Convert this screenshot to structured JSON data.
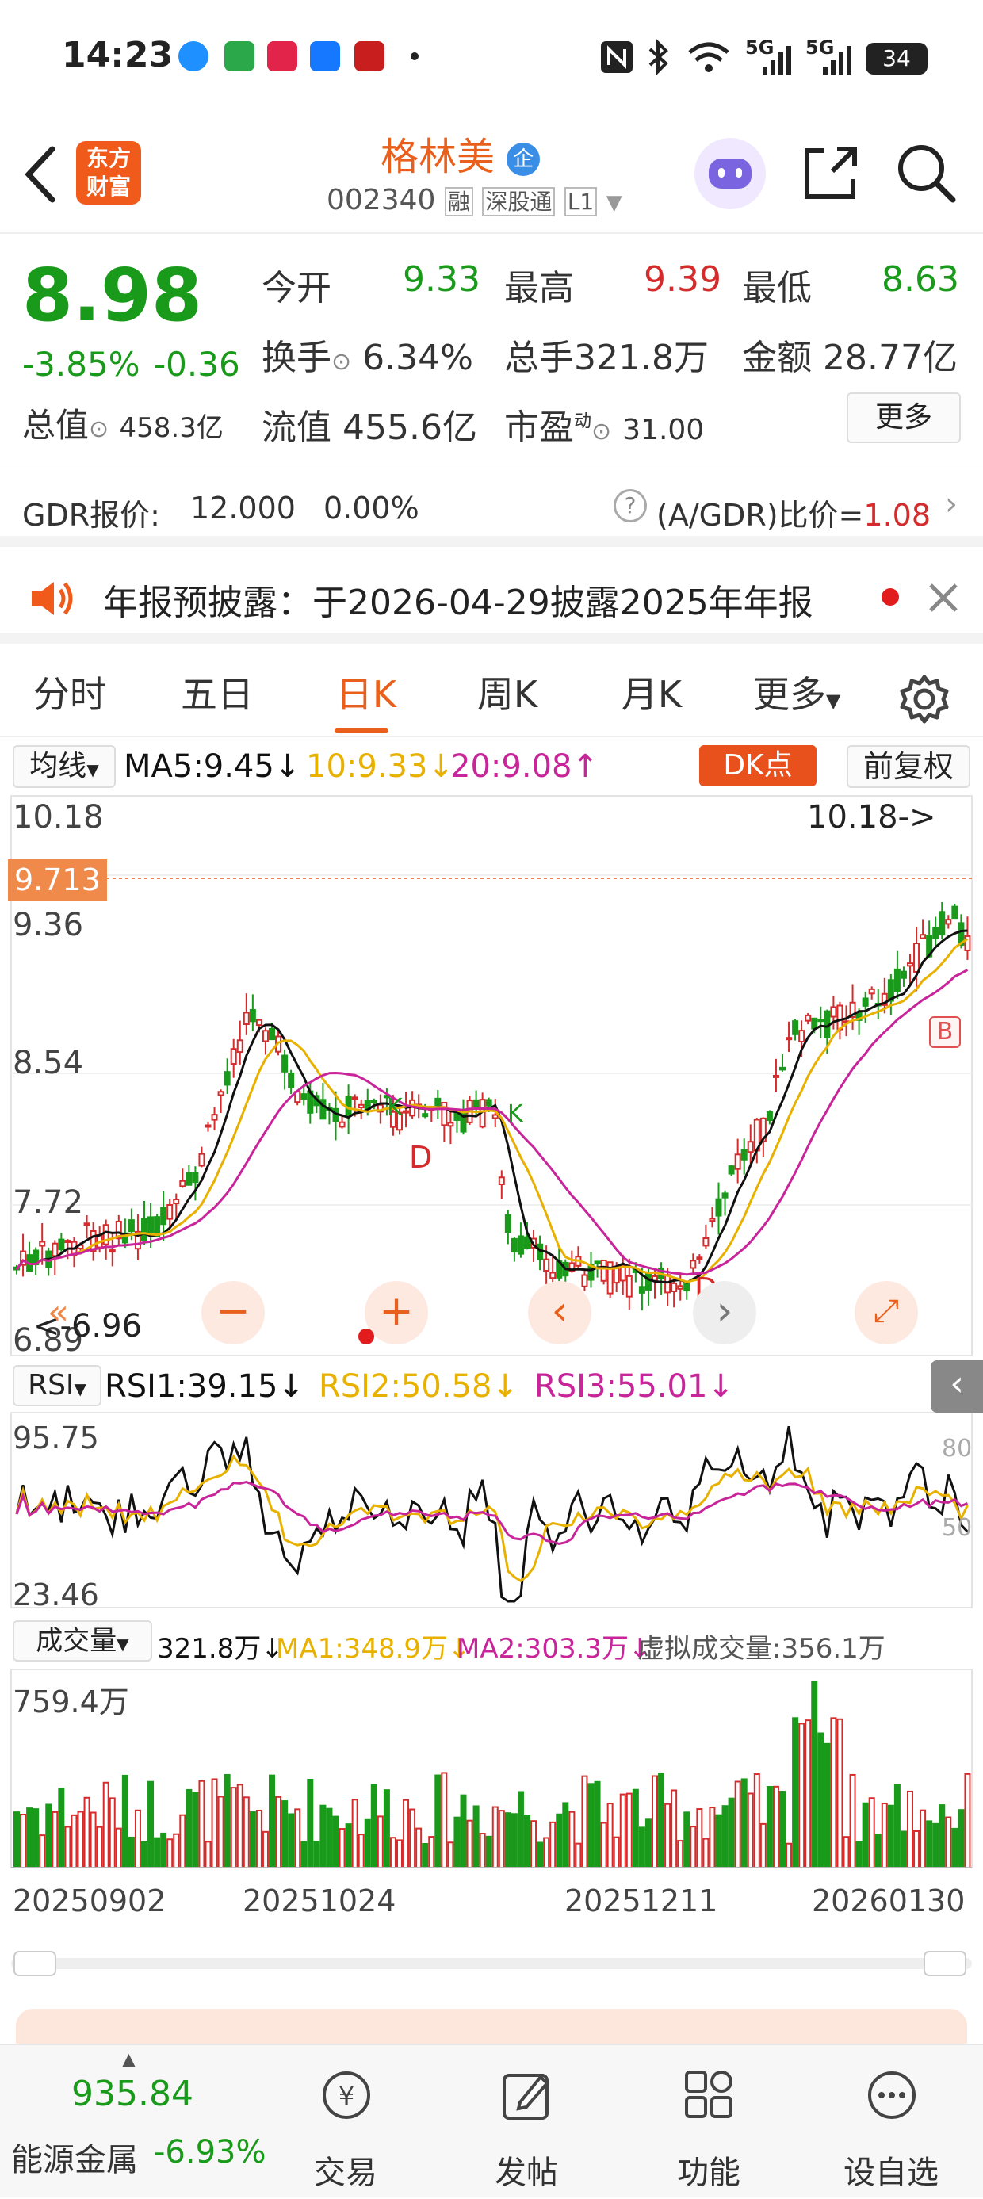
{
  "status": {
    "time": "14:23",
    "battery": "34",
    "network1": "5G",
    "network2": "5G"
  },
  "header": {
    "app_logo_line1": "东方",
    "app_logo_line2": "财富",
    "stock_name": "格林美",
    "badge": "企",
    "code": "002340",
    "tag1": "融",
    "tag2": "深股通",
    "tag3": "L1"
  },
  "quote": {
    "price": "8.98",
    "change_pct": "-3.85%",
    "change": "-0.36",
    "open_label": "今开",
    "open": "9.33",
    "high_label": "最高",
    "high": "9.39",
    "low_label": "最低",
    "low": "8.63",
    "turnover_label": "换手",
    "turnover": "6.34%",
    "volume_label": "总手",
    "volume": "321.8万",
    "amount_label": "金额",
    "amount": "28.77亿",
    "mcap_label": "总值",
    "mcap": "458.3亿",
    "float_label": "流值",
    "float": "455.6亿",
    "pe_label": "市盈",
    "pe_sup": "动",
    "pe": "31.00",
    "more": "更多"
  },
  "gdr": {
    "label": "GDR报价:",
    "price": "12.000",
    "pct": "0.00%",
    "ratio_label": "(A/GDR)比价=",
    "ratio": "1.08"
  },
  "notice": {
    "text": "年报预披露：于2026-04-29披露2025年年报"
  },
  "tabs": [
    "分时",
    "五日",
    "日K",
    "周K",
    "月K",
    "更多"
  ],
  "indicators": {
    "ma_selector": "均线",
    "ma5": "MA5:9.45↓",
    "ma10": "10:9.33↓",
    "ma20": "20:9.08↑",
    "dk_button": "DK点",
    "adjust_button": "前复权",
    "rsi_selector": "RSI",
    "rsi1": "RSI1:39.15↓",
    "rsi2": "RSI2:50.58↓",
    "rsi3": "RSI3:55.01↓",
    "vol_selector": "成交量",
    "vol": "321.8万↓",
    "vol_ma1": "MA1:348.9万↓",
    "vol_ma2": "MA2:303.3万↓",
    "virtual_vol": "虚拟成交量:356.1万"
  },
  "chart_labels": {
    "price_ticks": [
      "10.18",
      "9.36",
      "8.54",
      "7.72",
      "6.89"
    ],
    "current_price_tag": "9.713",
    "high_marker": "10.18->",
    "low_marker": "<-6.96",
    "rsi_ticks": [
      "95.75",
      "23.46"
    ],
    "rsi_right_ticks": [
      "80",
      "50"
    ],
    "vol_tick": "759.4万",
    "dates": [
      "20250902",
      "20251024",
      "20251211",
      "20260130"
    ],
    "signal_d": "D",
    "signal_k": "K",
    "signal_b": "B"
  },
  "bottom": {
    "index_value": "935.84",
    "index_name": "能源金属",
    "index_pct": "-6.93%",
    "nav": [
      "交易",
      "发帖",
      "功能",
      "设自选"
    ]
  },
  "colors": {
    "up": "#d42c2c",
    "down": "#1a9a1a",
    "accent": "#e8601c",
    "ma5": "#111111",
    "ma10": "#e8b100",
    "ma20": "#c8259a"
  }
}
